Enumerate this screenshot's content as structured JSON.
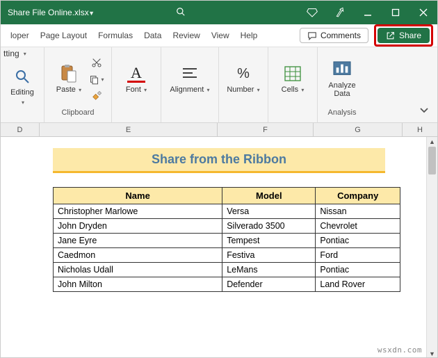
{
  "titlebar": {
    "filename": "Share File Online.xlsx"
  },
  "tabs": {
    "t0": "loper",
    "t1": "Page Layout",
    "t2": "Formulas",
    "t3": "Data",
    "t4": "Review",
    "t5": "View",
    "t6": "Help"
  },
  "topbtns": {
    "comments": "Comments",
    "share": "Share"
  },
  "ribbon": {
    "tting": "tting",
    "editing": "Editing",
    "paste": "Paste",
    "clipboard": "Clipboard",
    "font": "Font",
    "alignment": "Alignment",
    "number": "Number",
    "cells": "Cells",
    "analyze": "Analyze",
    "data": "Data",
    "analysis": "Analysis"
  },
  "cols": {
    "D": "D",
    "E": "E",
    "F": "F",
    "G": "G",
    "H": "H"
  },
  "heading": "Share from the Ribbon",
  "th": {
    "name": "Name",
    "model": "Model",
    "company": "Company"
  },
  "rows": [
    {
      "name": "Christopher Marlowe",
      "model": "Versa",
      "company": "Nissan"
    },
    {
      "name": "John Dryden",
      "model": "Silverado 3500",
      "company": "Chevrolet"
    },
    {
      "name": "Jane Eyre",
      "model": "Tempest",
      "company": "Pontiac"
    },
    {
      "name": "Caedmon",
      "model": "Festiva",
      "company": "Ford"
    },
    {
      "name": "Nicholas Udall",
      "model": "LeMans",
      "company": "Pontiac"
    },
    {
      "name": "John Milton",
      "model": "Defender",
      "company": "Land Rover"
    }
  ],
  "watermark": "wsxdn.com"
}
